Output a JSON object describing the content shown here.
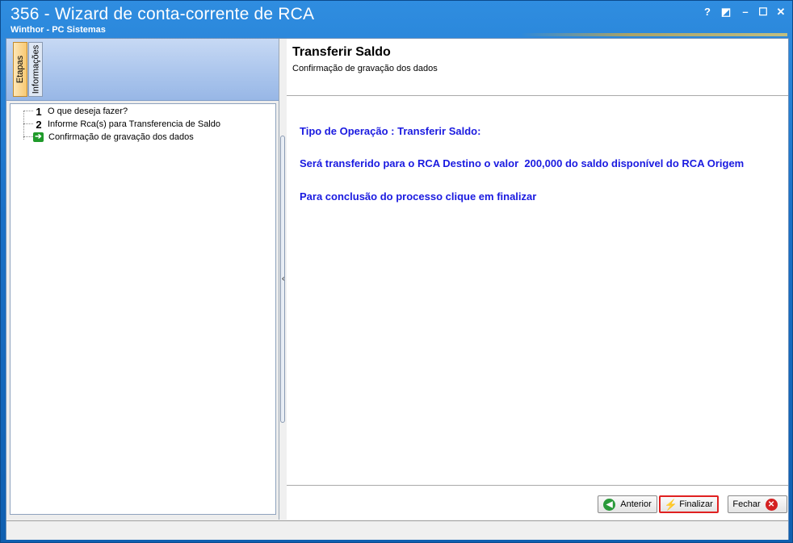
{
  "window": {
    "title": "356 - Wizard de conta-corrente de RCA",
    "subtitle": "Winthor - PC Sistemas",
    "help_btn": "?",
    "restore_btn": "◩",
    "minimize_btn": "–",
    "maximize_btn": "☐",
    "close_btn": "✕"
  },
  "left": {
    "tabs": [
      {
        "label": "Etapas",
        "active": true
      },
      {
        "label": "Informações",
        "active": false
      }
    ],
    "steps": [
      {
        "marker": "1",
        "label": "O que deseja fazer?"
      },
      {
        "marker": "2",
        "label": "Informe Rca(s) para Transferencia de Saldo"
      },
      {
        "marker": "arrow",
        "label": "Confirmação de gravação dos dados"
      }
    ]
  },
  "right": {
    "title": "Transferir Saldo",
    "subtitle": "Confirmação de gravação dos dados",
    "messages": [
      "Tipo de Operação : Transferir Saldo:",
      "Será transferido para o RCA Destino o valor  200,000 do saldo disponível do RCA Origem",
      "Para conclusão do processo clique em finalizar"
    ],
    "message_color": "#1a1ae0"
  },
  "buttons": {
    "anterior": "Anterior",
    "finalizar": "Finalizar",
    "fechar": "Fechar"
  },
  "colors": {
    "titlebar": "#1a70c6",
    "highlight_border": "#e02020"
  }
}
